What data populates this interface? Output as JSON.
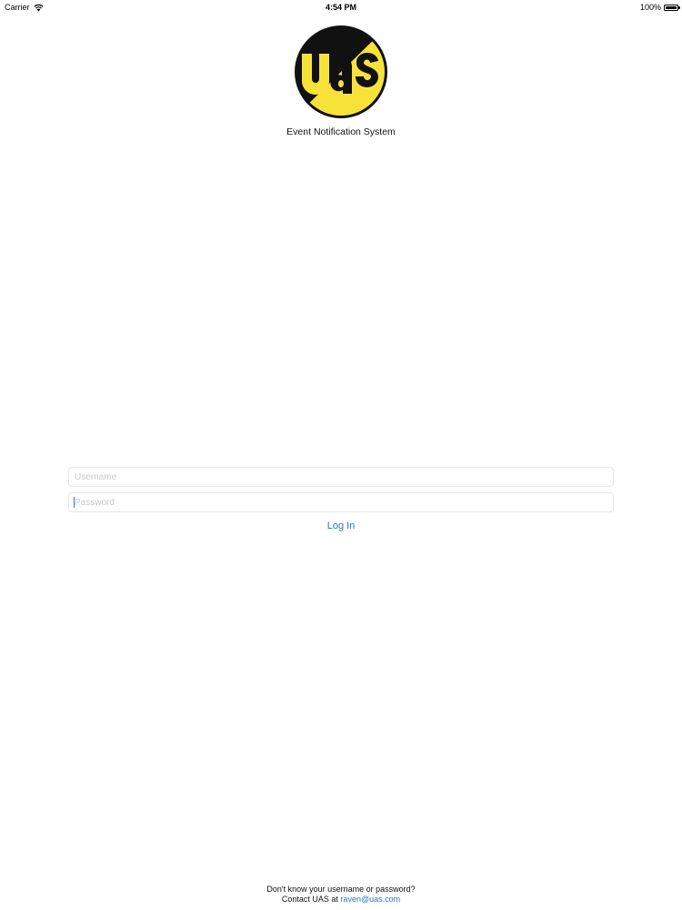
{
  "status_bar": {
    "carrier": "Carrier",
    "time": "4:54 PM",
    "battery": "100%",
    "icons": [
      "wifi-icon",
      "battery-icon"
    ]
  },
  "header": {
    "logo_text": "uas",
    "subtitle": "Event Notification System",
    "logo_colors": {
      "black": "#111111",
      "yellow": "#f7e23a"
    }
  },
  "login": {
    "username_placeholder": "Username",
    "password_placeholder": "Password",
    "button_label": "Log In"
  },
  "footer": {
    "line1": "Don't know your username or password?",
    "contact_prefix": "Contact UAS at",
    "email": "raven@uas.com"
  },
  "colors": {
    "link": "#2a7ab8",
    "field_border": "#e6e6e6",
    "placeholder": "#c7c7cd"
  }
}
